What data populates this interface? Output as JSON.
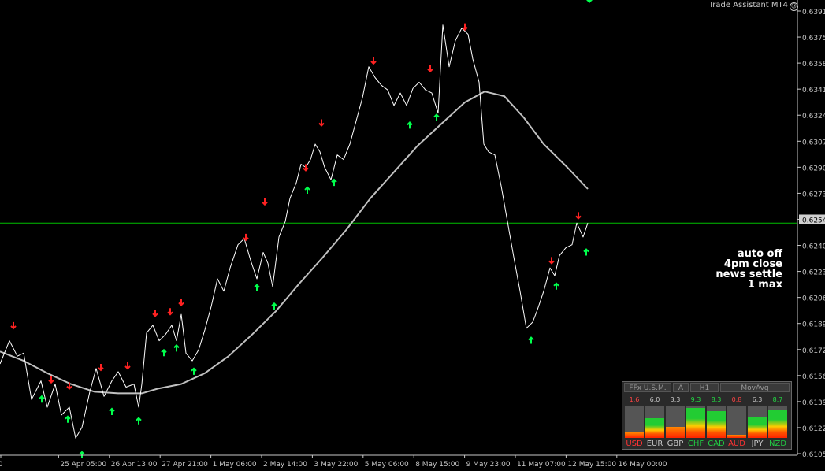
{
  "chart_data": {
    "type": "line",
    "title": "",
    "xlabel": "",
    "ylabel": "",
    "y_range": [
      0.61,
      0.64
    ],
    "y_ticks": [
      "0.6391",
      "0.6375",
      "0.6358",
      "0.6341",
      "0.6324",
      "0.6307",
      "0.6290",
      "0.6273",
      "0.6254",
      "0.6240",
      "0.6223",
      "0.6206",
      "0.6189",
      "0.6172",
      "0.6156",
      "0.6139",
      "0.6122",
      "0.6105"
    ],
    "x_ticks": [
      "00",
      "25 Apr 05:00",
      "26 Apr 13:00",
      "27 Apr 21:00",
      "1 May 06:00",
      "2 May 14:00",
      "3 May 22:00",
      "5 May 06:00",
      "8 May 15:00",
      "9 May 23:00",
      "11 May 07:00",
      "12 May 15:00",
      "16 May 00:00"
    ],
    "current_price": 0.6254,
    "current_price_label": "0.6254",
    "horizontal_line": 0.6254,
    "grid": false,
    "series": [
      {
        "role": "price",
        "color": "#ffffff",
        "points": [
          [
            0,
            0.6163
          ],
          [
            12,
            0.6178
          ],
          [
            22,
            0.6168
          ],
          [
            30,
            0.617
          ],
          [
            40,
            0.614
          ],
          [
            52,
            0.6152
          ],
          [
            60,
            0.6135
          ],
          [
            70,
            0.615
          ],
          [
            78,
            0.613
          ],
          [
            88,
            0.6135
          ],
          [
            96,
            0.6115
          ],
          [
            104,
            0.6122
          ],
          [
            114,
            0.6145
          ],
          [
            122,
            0.616
          ],
          [
            132,
            0.6142
          ],
          [
            142,
            0.6152
          ],
          [
            150,
            0.6158
          ],
          [
            160,
            0.6148
          ],
          [
            170,
            0.615
          ],
          [
            176,
            0.6135
          ],
          [
            180,
            0.615
          ],
          [
            186,
            0.6183
          ],
          [
            194,
            0.6188
          ],
          [
            202,
            0.6178
          ],
          [
            210,
            0.6182
          ],
          [
            218,
            0.6188
          ],
          [
            224,
            0.6178
          ],
          [
            230,
            0.6195
          ],
          [
            236,
            0.617
          ],
          [
            244,
            0.6165
          ],
          [
            252,
            0.6172
          ],
          [
            260,
            0.6185
          ],
          [
            268,
            0.62
          ],
          [
            276,
            0.6218
          ],
          [
            284,
            0.621
          ],
          [
            292,
            0.6225
          ],
          [
            302,
            0.624
          ],
          [
            310,
            0.6244
          ],
          [
            318,
            0.623
          ],
          [
            326,
            0.6218
          ],
          [
            334,
            0.6235
          ],
          [
            340,
            0.6228
          ],
          [
            346,
            0.6213
          ],
          [
            354,
            0.6245
          ],
          [
            362,
            0.6255
          ],
          [
            368,
            0.627
          ],
          [
            376,
            0.628
          ],
          [
            382,
            0.6292
          ],
          [
            388,
            0.629
          ],
          [
            394,
            0.6295
          ],
          [
            400,
            0.6305
          ],
          [
            406,
            0.63
          ],
          [
            412,
            0.629
          ],
          [
            420,
            0.6282
          ],
          [
            428,
            0.6298
          ],
          [
            436,
            0.6295
          ],
          [
            444,
            0.6305
          ],
          [
            452,
            0.632
          ],
          [
            460,
            0.6335
          ],
          [
            468,
            0.6355
          ],
          [
            476,
            0.6348
          ],
          [
            484,
            0.6343
          ],
          [
            492,
            0.634
          ],
          [
            500,
            0.633
          ],
          [
            508,
            0.6338
          ],
          [
            516,
            0.633
          ],
          [
            524,
            0.6341
          ],
          [
            532,
            0.6345
          ],
          [
            540,
            0.634
          ],
          [
            548,
            0.6338
          ],
          [
            556,
            0.6325
          ],
          [
            562,
            0.6382
          ],
          [
            570,
            0.6355
          ],
          [
            578,
            0.6372
          ],
          [
            586,
            0.638
          ],
          [
            594,
            0.6376
          ],
          [
            600,
            0.636
          ],
          [
            608,
            0.6345
          ],
          [
            614,
            0.6305
          ],
          [
            620,
            0.63
          ],
          [
            628,
            0.6298
          ],
          [
            636,
            0.6278
          ],
          [
            644,
            0.6255
          ],
          [
            652,
            0.6232
          ],
          [
            660,
            0.621
          ],
          [
            668,
            0.6186
          ],
          [
            676,
            0.619
          ],
          [
            682,
            0.6198
          ],
          [
            690,
            0.621
          ],
          [
            698,
            0.6225
          ],
          [
            704,
            0.622
          ],
          [
            710,
            0.6233
          ],
          [
            718,
            0.6238
          ],
          [
            726,
            0.624
          ],
          [
            732,
            0.6254
          ],
          [
            740,
            0.6245
          ],
          [
            746,
            0.6254
          ]
        ]
      },
      {
        "role": "moving-average",
        "color": "#c0c0c0",
        "points": [
          [
            0,
            0.6171
          ],
          [
            30,
            0.6165
          ],
          [
            60,
            0.6157
          ],
          [
            90,
            0.615
          ],
          [
            120,
            0.6145
          ],
          [
            150,
            0.6144
          ],
          [
            180,
            0.6144
          ],
          [
            200,
            0.6147
          ],
          [
            230,
            0.615
          ],
          [
            260,
            0.6157
          ],
          [
            290,
            0.6168
          ],
          [
            320,
            0.6182
          ],
          [
            350,
            0.6197
          ],
          [
            380,
            0.6215
          ],
          [
            410,
            0.6232
          ],
          [
            440,
            0.625
          ],
          [
            470,
            0.627
          ],
          [
            500,
            0.6287
          ],
          [
            530,
            0.6304
          ],
          [
            560,
            0.6318
          ],
          [
            590,
            0.6332
          ],
          [
            615,
            0.6339
          ],
          [
            640,
            0.6336
          ],
          [
            665,
            0.6322
          ],
          [
            690,
            0.6305
          ],
          [
            720,
            0.629
          ],
          [
            746,
            0.6276
          ]
        ]
      }
    ],
    "signals": {
      "up_color": "#00ff4c",
      "down_color": "#ff2222",
      "up": [
        [
          53,
          0.614
        ],
        [
          86,
          0.6127
        ],
        [
          104,
          0.6104
        ],
        [
          142,
          0.6132
        ],
        [
          176,
          0.6126
        ],
        [
          208,
          0.617
        ],
        [
          224,
          0.6173
        ],
        [
          246,
          0.6158
        ],
        [
          326,
          0.6212
        ],
        [
          348,
          0.62
        ],
        [
          390,
          0.6275
        ],
        [
          424,
          0.628
        ],
        [
          520,
          0.6317
        ],
        [
          554,
          0.6322
        ],
        [
          674,
          0.6178
        ],
        [
          706,
          0.6213
        ],
        [
          744,
          0.6235
        ]
      ],
      "down": [
        [
          17,
          0.6188
        ],
        [
          65,
          0.6153
        ],
        [
          88,
          0.6149
        ],
        [
          128,
          0.6161
        ],
        [
          162,
          0.6162
        ],
        [
          197,
          0.6196
        ],
        [
          216,
          0.6197
        ],
        [
          230,
          0.6203
        ],
        [
          312,
          0.6245
        ],
        [
          336,
          0.6268
        ],
        [
          388,
          0.629
        ],
        [
          408,
          0.6319
        ],
        [
          474,
          0.6359
        ],
        [
          546,
          0.6354
        ],
        [
          590,
          0.6381
        ],
        [
          700,
          0.623
        ],
        [
          734,
          0.6259
        ]
      ],
      "corner_marker_color": "#00ff4c"
    }
  },
  "assistant": {
    "title": "Trade Assistant MT4",
    "icon_name": "smiley-icon",
    "icon_glyph": "☺"
  },
  "overlay": {
    "lines": [
      "auto off",
      "4pm close",
      "news settle",
      "1 max"
    ]
  },
  "panel": {
    "headers": [
      "FFx U.S.M.",
      "A",
      "H1",
      "MovAvg"
    ],
    "currencies": [
      {
        "code": "USD",
        "value": "1.6",
        "value_color": "#ff4444",
        "label_color": "#ff3333",
        "fill": 0.16,
        "fill_color": "red"
      },
      {
        "code": "EUR",
        "value": "6.0",
        "value_color": "#c8c8c8",
        "label_color": "#c8c8c8",
        "fill": 0.6,
        "fill_color": "mixed"
      },
      {
        "code": "GBP",
        "value": "3.3",
        "value_color": "#c8c8c8",
        "label_color": "#c8c8c8",
        "fill": 0.33,
        "fill_color": "red"
      },
      {
        "code": "CHF",
        "value": "9.3",
        "value_color": "#22dd44",
        "label_color": "#22cc44",
        "fill": 0.93,
        "fill_color": "mixed"
      },
      {
        "code": "CAD",
        "value": "8.3",
        "value_color": "#22dd44",
        "label_color": "#22cc44",
        "fill": 0.83,
        "fill_color": "mixed"
      },
      {
        "code": "AUD",
        "value": "0.8",
        "value_color": "#ff4444",
        "label_color": "#ff3333",
        "fill": 0.08,
        "fill_color": "red"
      },
      {
        "code": "JPY",
        "value": "6.3",
        "value_color": "#c8c8c8",
        "label_color": "#c8c8c8",
        "fill": 0.63,
        "fill_color": "mixed"
      },
      {
        "code": "NZD",
        "value": "8.7",
        "value_color": "#22dd44",
        "label_color": "#22cc44",
        "fill": 0.87,
        "fill_color": "mixed"
      }
    ]
  },
  "colors": {
    "background": "#000000",
    "axis": "#c8c8c8",
    "hline": "#00c000"
  }
}
